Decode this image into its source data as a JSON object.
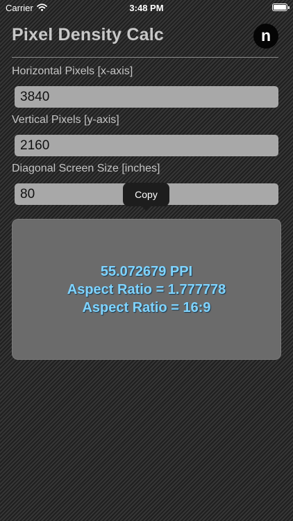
{
  "status_bar": {
    "carrier": "Carrier",
    "time": "3:48 PM"
  },
  "header": {
    "title": "Pixel Density Calc",
    "logo_letter": "n"
  },
  "fields": {
    "horizontal": {
      "label": "Horizontal Pixels  [x-axis]",
      "value": "3840"
    },
    "vertical": {
      "label": "Vertical Pixels [y-axis]",
      "value": "2160"
    },
    "diagonal": {
      "label": "Diagonal Screen Size [inches]",
      "value": "80"
    }
  },
  "tooltip": {
    "label": "Copy"
  },
  "results": {
    "ppi": "55.072679 PPI",
    "aspect_decimal": "Aspect Ratio = 1.777778",
    "aspect_ratio": "Aspect Ratio = 16:9"
  },
  "colors": {
    "result_text": "#7fd4ff",
    "field_background": "#a8a8a8",
    "panel_background": "#6b6b6b"
  }
}
